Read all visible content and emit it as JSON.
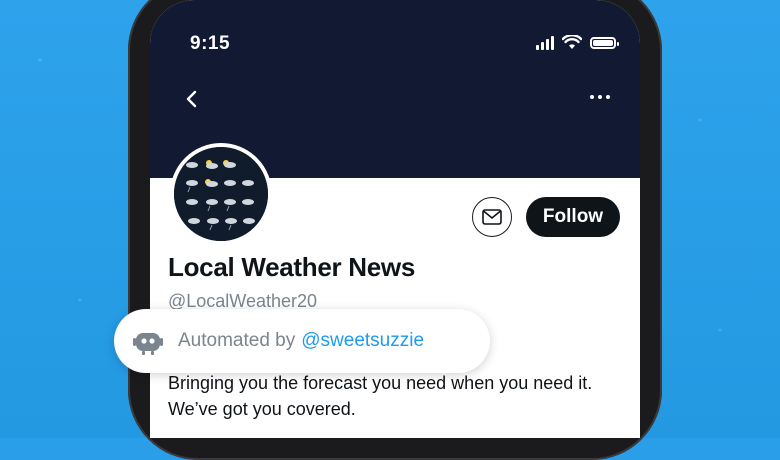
{
  "status_bar": {
    "time": "9:15"
  },
  "profile": {
    "display_name": "Local Weather News",
    "handle": "@LocalWeather20",
    "follow_label": "Follow",
    "bio": "Bringing you the forecast you need when you need it.  We’ve got you covered."
  },
  "automation": {
    "prefix": "Automated by",
    "account": "@sweetsuzzie"
  },
  "colors": {
    "background": "#2a9ee8",
    "header": "#121a33",
    "follow_button": "#0f1419",
    "link": "#1d9bf0",
    "muted_text": "#7a8590"
  },
  "icons": [
    "back-icon",
    "more-icon",
    "mail-icon",
    "bot-icon",
    "signal-icon",
    "wifi-icon",
    "battery-icon"
  ]
}
